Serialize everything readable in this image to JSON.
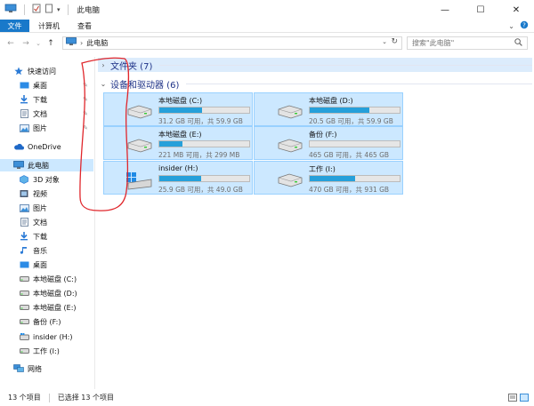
{
  "window": {
    "title": "此电脑",
    "minimize": "—",
    "maximize": "☐",
    "close": "✕"
  },
  "ribbon": {
    "tabs": [
      "文件",
      "计算机",
      "查看"
    ],
    "expand_icon": "chevron-down-icon",
    "help_icon": "help-icon"
  },
  "address": {
    "path": "此电脑",
    "refresh_icon": "refresh-icon",
    "search_placeholder": "搜索\"此电脑\""
  },
  "sidebar": {
    "items": [
      {
        "label": "快速访问",
        "icon": "star-icon"
      },
      {
        "label": "桌面",
        "icon": "desktop-icon",
        "pinned": true
      },
      {
        "label": "下载",
        "icon": "download-icon",
        "pinned": true
      },
      {
        "label": "文档",
        "icon": "document-icon",
        "pinned": true
      },
      {
        "label": "图片",
        "icon": "picture-icon",
        "pinned": true
      },
      {
        "label": "OneDrive",
        "icon": "cloud-icon"
      },
      {
        "label": "此电脑",
        "icon": "computer-icon",
        "selected": true
      },
      {
        "label": "3D 对象",
        "icon": "cube-icon"
      },
      {
        "label": "视频",
        "icon": "video-icon"
      },
      {
        "label": "图片",
        "icon": "picture-icon"
      },
      {
        "label": "文档",
        "icon": "document-icon"
      },
      {
        "label": "下载",
        "icon": "download-icon"
      },
      {
        "label": "音乐",
        "icon": "music-icon"
      },
      {
        "label": "桌面",
        "icon": "desktop-icon"
      },
      {
        "label": "本地磁盘 (C:)",
        "icon": "drive-icon"
      },
      {
        "label": "本地磁盘 (D:)",
        "icon": "drive-icon"
      },
      {
        "label": "本地磁盘 (E:)",
        "icon": "drive-icon"
      },
      {
        "label": "备份 (F:)",
        "icon": "drive-icon"
      },
      {
        "label": "insider (H:)",
        "icon": "drive-icon"
      },
      {
        "label": "工作 (I:)",
        "icon": "drive-icon"
      },
      {
        "label": "网络",
        "icon": "network-icon"
      }
    ]
  },
  "main": {
    "folders_header": "文件夹 (7)",
    "drives_header": "设备和驱动器 (6)",
    "drives": [
      {
        "name": "本地磁盘 (C:)",
        "info": "31.2 GB 可用，共 59.9 GB",
        "used_fraction": 0.48,
        "windows": false
      },
      {
        "name": "本地磁盘 (D:)",
        "info": "20.5 GB 可用，共 59.9 GB",
        "used_fraction": 0.66,
        "windows": false
      },
      {
        "name": "本地磁盘 (E:)",
        "info": "221 MB 可用，共 299 MB",
        "used_fraction": 0.26,
        "windows": false
      },
      {
        "name": "备份 (F:)",
        "info": "465 GB 可用，共 465 GB",
        "used_fraction": 0.0,
        "windows": false
      },
      {
        "name": "insider (H:)",
        "info": "25.9 GB 可用，共 49.0 GB",
        "used_fraction": 0.47,
        "windows": true
      },
      {
        "name": "工作 (I:)",
        "info": "470 GB 可用，共 931 GB",
        "used_fraction": 0.5,
        "windows": false
      }
    ]
  },
  "status": {
    "count": "13 个项目",
    "selected": "已选择 13 个项目"
  },
  "colors": {
    "accent": "#1979ca",
    "selection": "#cce8ff",
    "bar_fill": "#26a0da",
    "annotation": "#e0262b"
  }
}
